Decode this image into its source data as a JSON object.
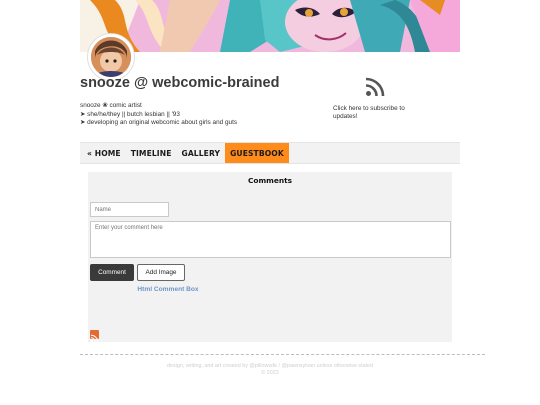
{
  "header": {
    "title": "snooze @ webcomic-brained",
    "bio": [
      "snooze ❀ comic artist",
      "➤ she/he/they || butch lesbian || '93",
      "➤ developing an original webcomic about girls and guts"
    ],
    "subscribe_text": "Click here to subscribe to updates!",
    "banner_image": "illustrated-character-banner",
    "avatar_image": "character-avatar",
    "feed_icon": "rss-icon"
  },
  "nav": {
    "items": [
      {
        "label": "« HOME",
        "active": false
      },
      {
        "label": "TIMELINE",
        "active": false
      },
      {
        "label": "GALLERY",
        "active": false
      },
      {
        "label": "GUESTBOOK",
        "active": true
      }
    ],
    "active_color": "#ff8c1a"
  },
  "comments": {
    "title": "Comments",
    "name_placeholder": "Name",
    "comment_placeholder": "Enter your comment here",
    "comment_button": "Comment",
    "image_button": "Add Image",
    "link_text": "Html Comment Box",
    "feed_icon": "rss-icon"
  },
  "footer": {
    "line1": "design, writing, and art created by @pillowsde / @pawnsylvan unless otherwise stated",
    "line2": "© 2023"
  },
  "colors": {
    "accent": "#ff8c1a",
    "link": "#6f95c9",
    "panel": "#f2f2f2",
    "dark_button": "#3a3a3a"
  }
}
